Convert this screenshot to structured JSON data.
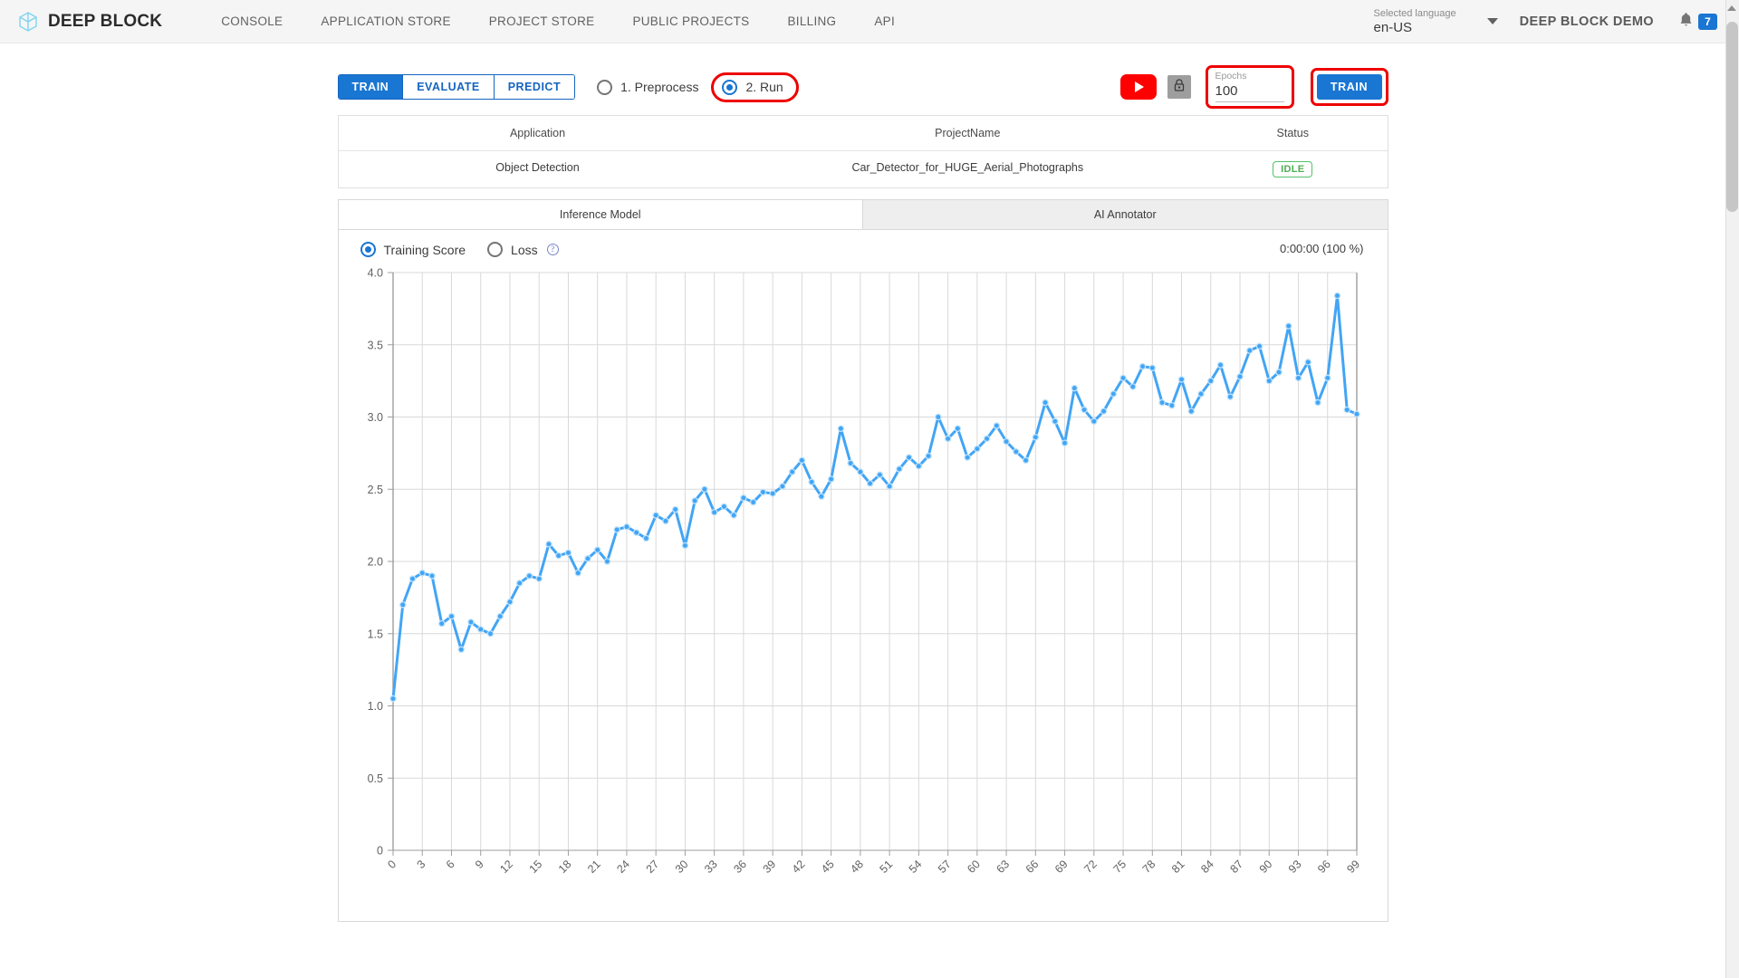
{
  "header": {
    "brand": "DEEP BLOCK",
    "nav": [
      {
        "label": "CONSOLE"
      },
      {
        "label": "APPLICATION STORE"
      },
      {
        "label": "PROJECT STORE"
      },
      {
        "label": "PUBLIC PROJECTS"
      },
      {
        "label": "BILLING"
      },
      {
        "label": "API"
      }
    ],
    "language": {
      "caption": "Selected language",
      "value": "en-US"
    },
    "user": "DEEP BLOCK DEMO",
    "notification_count": "7"
  },
  "toolbar": {
    "modes": [
      {
        "label": "TRAIN",
        "active": true
      },
      {
        "label": "EVALUATE",
        "active": false
      },
      {
        "label": "PREDICT",
        "active": false
      }
    ],
    "steps": [
      {
        "label": "1. Preprocess",
        "checked": false,
        "highlighted": false
      },
      {
        "label": "2. Run",
        "checked": true,
        "highlighted": true
      }
    ],
    "epochs": {
      "label": "Epochs",
      "value": "100",
      "placeholder": "Epochs"
    },
    "train_button": "TRAIN",
    "accent_color": "#1976d2",
    "highlight_color": "#ee0000"
  },
  "table": {
    "columns": [
      "Application",
      "ProjectName",
      "Status"
    ],
    "rows": [
      {
        "application": "Object Detection",
        "project_name": "Car_Detector_for_HUGE_Aerial_Photographs",
        "status": "IDLE"
      }
    ]
  },
  "chart_panel": {
    "tabs": [
      {
        "label": "Inference Model",
        "active": true
      },
      {
        "label": "AI Annotator",
        "active": false
      }
    ],
    "metrics": [
      {
        "label": "Training Score",
        "checked": true
      },
      {
        "label": "Loss",
        "checked": false,
        "help": "?"
      }
    ],
    "timer": "0:00:00 (100 %)"
  },
  "chart_data": {
    "type": "line",
    "title": "",
    "xlabel": "",
    "ylabel": "",
    "series_name": "Training Score",
    "line_color": "#42a5f5",
    "grid": true,
    "legend": "none",
    "xlim": [
      0,
      99
    ],
    "ylim": [
      0,
      4.0
    ],
    "ytick_labels": [
      "0",
      "0.5",
      "1.0",
      "1.5",
      "2.0",
      "2.5",
      "3.0",
      "3.5",
      "4.0"
    ],
    "yticks": [
      0,
      0.5,
      1.0,
      1.5,
      2.0,
      2.5,
      3.0,
      3.5,
      4.0
    ],
    "xtick_labels": [
      "0",
      "3",
      "6",
      "9",
      "12",
      "15",
      "18",
      "21",
      "24",
      "27",
      "30",
      "33",
      "36",
      "39",
      "42",
      "45",
      "48",
      "51",
      "54",
      "57",
      "60",
      "63",
      "66",
      "69",
      "72",
      "75",
      "78",
      "81",
      "84",
      "87",
      "90",
      "93",
      "96",
      "99"
    ],
    "xticks": [
      0,
      3,
      6,
      9,
      12,
      15,
      18,
      21,
      24,
      27,
      30,
      33,
      36,
      39,
      42,
      45,
      48,
      51,
      54,
      57,
      60,
      63,
      66,
      69,
      72,
      75,
      78,
      81,
      84,
      87,
      90,
      93,
      96,
      99
    ],
    "x": [
      0,
      1,
      2,
      3,
      4,
      5,
      6,
      7,
      8,
      9,
      10,
      11,
      12,
      13,
      14,
      15,
      16,
      17,
      18,
      19,
      20,
      21,
      22,
      23,
      24,
      25,
      26,
      27,
      28,
      29,
      30,
      31,
      32,
      33,
      34,
      35,
      36,
      37,
      38,
      39,
      40,
      41,
      42,
      43,
      44,
      45,
      46,
      47,
      48,
      49,
      50,
      51,
      52,
      53,
      54,
      55,
      56,
      57,
      58,
      59,
      60,
      61,
      62,
      63,
      64,
      65,
      66,
      67,
      68,
      69,
      70,
      71,
      72,
      73,
      74,
      75,
      76,
      77,
      78,
      79,
      80,
      81,
      82,
      83,
      84,
      85,
      86,
      87,
      88,
      89,
      90,
      91,
      92,
      93,
      94,
      95,
      96,
      97,
      98,
      99
    ],
    "values": [
      1.05,
      1.7,
      1.88,
      1.92,
      1.9,
      1.57,
      1.62,
      1.39,
      1.58,
      1.53,
      1.5,
      1.62,
      1.72,
      1.85,
      1.9,
      1.88,
      2.12,
      2.04,
      2.06,
      1.92,
      2.02,
      2.08,
      2.0,
      2.22,
      2.24,
      2.2,
      2.16,
      2.32,
      2.28,
      2.36,
      2.11,
      2.42,
      2.5,
      2.34,
      2.38,
      2.32,
      2.44,
      2.41,
      2.48,
      2.47,
      2.52,
      2.62,
      2.7,
      2.55,
      2.45,
      2.57,
      2.92,
      2.68,
      2.62,
      2.54,
      2.6,
      2.52,
      2.64,
      2.72,
      2.66,
      2.73,
      3.0,
      2.85,
      2.92,
      2.72,
      2.78,
      2.85,
      2.94,
      2.83,
      2.76,
      2.7,
      2.86,
      3.1,
      2.97,
      2.82,
      3.2,
      3.05,
      2.97,
      3.04,
      3.16,
      3.27,
      3.21,
      3.35,
      3.34,
      3.1,
      3.08,
      3.26,
      3.04,
      3.16,
      3.25,
      3.36,
      3.14,
      3.28,
      3.46,
      3.49,
      3.25,
      3.31,
      3.63,
      3.27,
      3.38,
      3.1,
      3.27,
      3.84,
      3.05,
      3.02
    ]
  }
}
